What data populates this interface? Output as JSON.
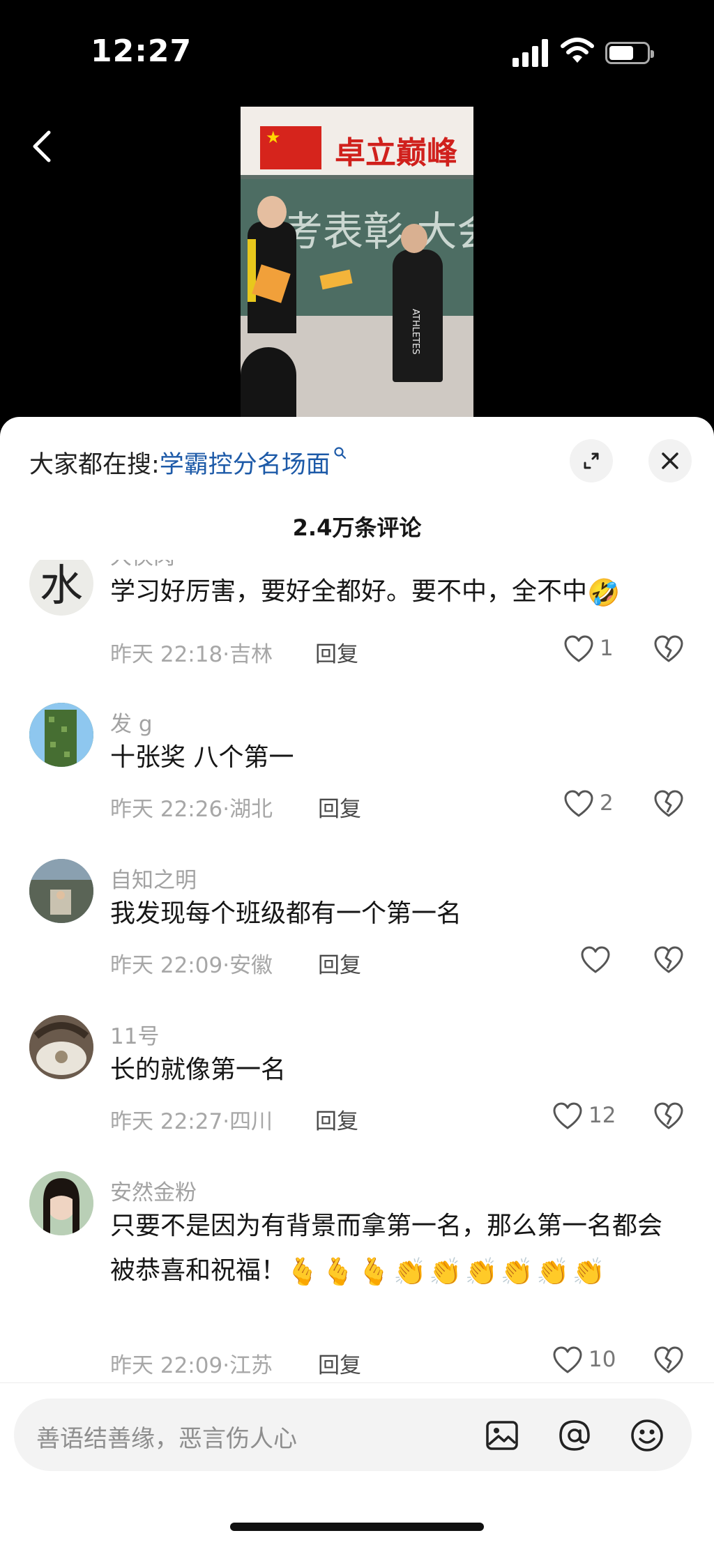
{
  "status_bar": {
    "time": "12:27"
  },
  "sheet": {
    "search_prefix": "大家都在搜:",
    "search_term": "学霸控分名场面",
    "comment_count": "2.4万条评论",
    "comments": [
      {
        "user": "大侠肉",
        "text": "学习好厉害，要好全都好。要不中，全不中",
        "emoji": "🤣",
        "date": "昨天 22:18",
        "location": "吉林",
        "reply": "回复",
        "likes": "1"
      },
      {
        "user": "发 g",
        "text": "十张奖 八个第一",
        "date": "昨天 22:26",
        "location": "湖北",
        "reply": "回复",
        "likes": "2"
      },
      {
        "user": "自知之明",
        "text": "我发现每个班级都有一个第一名",
        "date": "昨天 22:09",
        "location": "安徽",
        "reply": "回复",
        "likes": ""
      },
      {
        "user": "11号",
        "text": "长的就像第一名",
        "date": "昨天 22:27",
        "location": "四川",
        "reply": "回复",
        "likes": "12"
      },
      {
        "user": "安然金粉",
        "text": "只要不是因为有背景而拿第一名，那么第一名都会被恭喜和祝福！",
        "emoji": "🫰🫰🫰👏👏👏👏👏👏",
        "date": "昨天 22:09",
        "location": "江苏",
        "reply": "回复",
        "likes": "10"
      }
    ]
  },
  "video": {
    "slogan": "卓立巅峰",
    "board_text": "考表彰 大会",
    "shirt_text": "ATHLETES"
  },
  "input": {
    "placeholder": "善语结善缘，恶言伤人心"
  },
  "icons": {
    "back": "chevron-left-icon",
    "search": "search-icon",
    "expand": "expand-icon",
    "close": "close-icon",
    "like": "heart-outline-icon",
    "dislike": "broken-heart-icon",
    "image": "image-icon",
    "mention": "at-icon",
    "emoji": "emoji-icon"
  },
  "colors": {
    "search_term": "#1d5aa8",
    "meta": "#a7a7a7",
    "background": "#000000"
  }
}
